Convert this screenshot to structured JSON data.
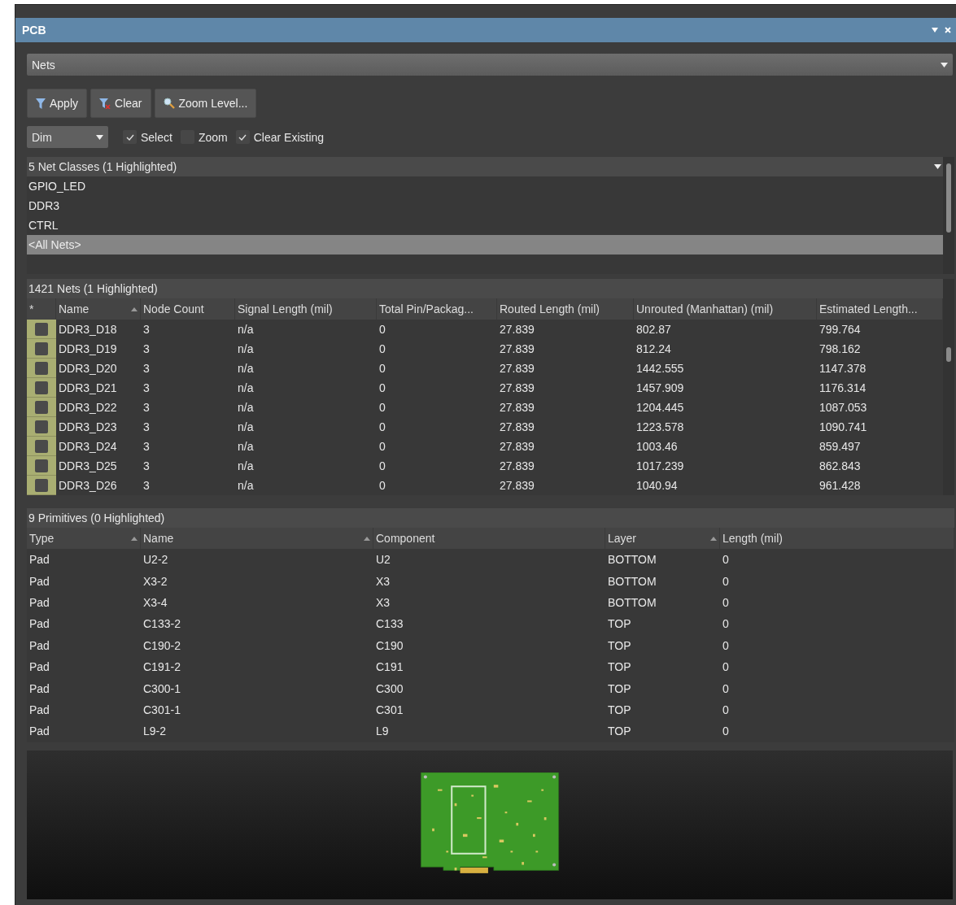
{
  "window": {
    "title": "PCB"
  },
  "mode_dropdown": {
    "value": "Nets"
  },
  "buttons": [
    {
      "kind": "apply",
      "label": "Apply"
    },
    {
      "kind": "clear",
      "label": "Clear"
    },
    {
      "kind": "zoom",
      "label": "Zoom Level..."
    }
  ],
  "options": {
    "mask_dropdown": {
      "value": "Dim"
    },
    "checkboxes": [
      {
        "label": "Select",
        "checked": true
      },
      {
        "label": "Zoom",
        "checked": false
      },
      {
        "label": "Clear Existing",
        "checked": true
      }
    ]
  },
  "net_classes": {
    "title": "5 Net Classes (1 Highlighted)",
    "items": [
      {
        "label": "GPIO_LED",
        "selected": false
      },
      {
        "label": "DDR3",
        "selected": false
      },
      {
        "label": "CTRL",
        "selected": false
      },
      {
        "label": "<All Nets>",
        "selected": true
      }
    ]
  },
  "nets": {
    "title": "1421 Nets (1 Highlighted)",
    "columns": [
      {
        "label": "*",
        "sorted": false
      },
      {
        "label": "Name",
        "sorted": true
      },
      {
        "label": "Node Count",
        "sorted": false
      },
      {
        "label": "Signal Length (mil)",
        "sorted": false
      },
      {
        "label": "Total Pin/Packag...",
        "sorted": false
      },
      {
        "label": "Routed Length (mil)",
        "sorted": false
      },
      {
        "label": "Unrouted (Manhattan) (mil)",
        "sorted": false
      },
      {
        "label": "Estimated Length...",
        "sorted": false
      }
    ],
    "rows": [
      [
        "",
        "DDR3_D18",
        "3",
        "n/a",
        "0",
        "27.839",
        "802.87",
        "799.764"
      ],
      [
        "",
        "DDR3_D19",
        "3",
        "n/a",
        "0",
        "27.839",
        "812.24",
        "798.162"
      ],
      [
        "",
        "DDR3_D20",
        "3",
        "n/a",
        "0",
        "27.839",
        "1442.555",
        "1147.378"
      ],
      [
        "",
        "DDR3_D21",
        "3",
        "n/a",
        "0",
        "27.839",
        "1457.909",
        "1176.314"
      ],
      [
        "",
        "DDR3_D22",
        "3",
        "n/a",
        "0",
        "27.839",
        "1204.445",
        "1087.053"
      ],
      [
        "",
        "DDR3_D23",
        "3",
        "n/a",
        "0",
        "27.839",
        "1223.578",
        "1090.741"
      ],
      [
        "",
        "DDR3_D24",
        "3",
        "n/a",
        "0",
        "27.839",
        "1003.46",
        "859.497"
      ],
      [
        "",
        "DDR3_D25",
        "3",
        "n/a",
        "0",
        "27.839",
        "1017.239",
        "862.843"
      ],
      [
        "",
        "DDR3_D26",
        "3",
        "n/a",
        "0",
        "27.839",
        "1040.94",
        "961.428"
      ]
    ]
  },
  "primitives": {
    "title": "9 Primitives (0 Highlighted)",
    "columns": [
      {
        "label": "Type",
        "sorted": true
      },
      {
        "label": "Name",
        "sorted": true
      },
      {
        "label": "Component",
        "sorted": false
      },
      {
        "label": "Layer",
        "sorted": true
      },
      {
        "label": "Length (mil)",
        "sorted": false
      }
    ],
    "rows": [
      [
        "Pad",
        "U2-2",
        "U2",
        "BOTTOM",
        "0"
      ],
      [
        "Pad",
        "X3-2",
        "X3",
        "BOTTOM",
        "0"
      ],
      [
        "Pad",
        "X3-4",
        "X3",
        "BOTTOM",
        "0"
      ],
      [
        "Pad",
        "C133-2",
        "C133",
        "TOP",
        "0"
      ],
      [
        "Pad",
        "C190-2",
        "C190",
        "TOP",
        "0"
      ],
      [
        "Pad",
        "C191-2",
        "C191",
        "TOP",
        "0"
      ],
      [
        "Pad",
        "C300-1",
        "C300",
        "TOP",
        "0"
      ],
      [
        "Pad",
        "C301-1",
        "C301",
        "TOP",
        "0"
      ],
      [
        "Pad",
        "L9-2",
        "L9",
        "TOP",
        "0"
      ]
    ]
  }
}
